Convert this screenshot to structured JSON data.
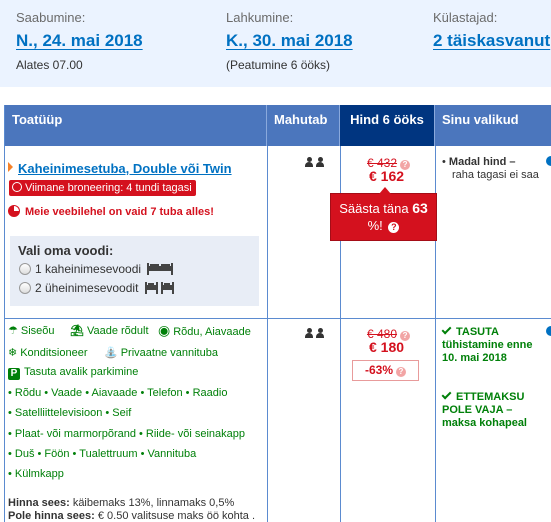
{
  "top": {
    "checkin": {
      "label": "Saabumine:",
      "value": "N., 24. mai 2018",
      "sub": "Alates 07.00"
    },
    "checkout": {
      "label": "Lahkumine:",
      "value": "K., 30. mai 2018",
      "sub": "(Peatumine 6 ööks)"
    },
    "guests": {
      "label": "Külastajad:",
      "value": "2 täiskasvanut"
    }
  },
  "table": {
    "headers": {
      "room_type": "Toatüüp",
      "capacity": "Mahutab",
      "price": "Hind 6 ööks",
      "choices": "Sinu valikud"
    }
  },
  "room": {
    "name": "Kaheinimesetuba, Double või Twin",
    "recent_booking": "Viimane broneering: 4 tundi tagasi",
    "rooms_left": "Meie veebilehel on vaid 7 tuba alles!",
    "bed_choice": {
      "title": "Vali oma voodi:",
      "options": [
        "1 kaheinimesevoodi",
        "2 üheinimesevoodit"
      ]
    }
  },
  "rates": [
    {
      "old_price": "€ 432",
      "new_price": "€ 162",
      "save": {
        "text": "Säästa täna",
        "pct": "63",
        "suffix": "%!"
      },
      "choice_bold": "Madal hind –",
      "choice_rest": "raha tagasi ei saa"
    },
    {
      "old_price": "€ 480",
      "new_price": "€ 180",
      "discount": "-63%",
      "choice1": "TASUTA tühistamine enne 10. mai 2018",
      "choice2_bold": "ETTEMAKSU POLE VAJA",
      "choice2_rest": "– maksa kohapeal"
    }
  ],
  "facilities": {
    "row1": [
      "Siseõu",
      "Vaade rõdult",
      "Rõdu, Aiavaade"
    ],
    "row2": [
      "Konditsioneer",
      "Privaatne vannituba"
    ],
    "row3": "Tasuta avalik parkimine",
    "list": [
      "• Rõdu • Vaade • Aiavaade • Telefon • Raadio",
      "• Satelliittelevisioon • Seif",
      "• Plaat- või marmorpõrand • Riide- või seinakapp",
      "• Duš • Föön • Tualettruum • Vannituba",
      "• Külmkapp"
    ],
    "tax_label": "Hinna sees:",
    "tax_text": "käibemaks 13%, linnamaks 0,5%",
    "excl_label": "Pole hinna sees:",
    "excl_text": "€ 0.50 valitsuse maks öö kohta ."
  },
  "colors": {
    "accent": "#0071c2",
    "header": "#4b76bd",
    "price_header": "#003580",
    "alert": "#d4111e",
    "green": "#008009"
  }
}
